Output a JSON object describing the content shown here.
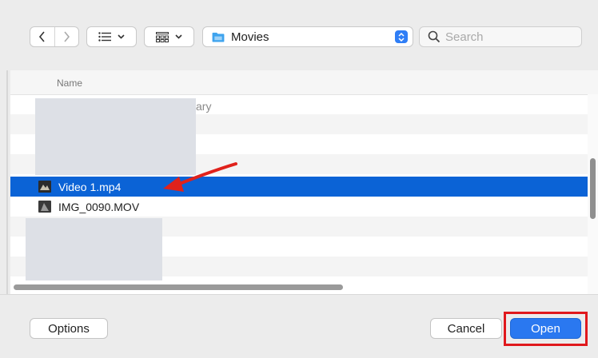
{
  "toolbar": {
    "back_icon": "chevron-left-icon",
    "forward_icon": "chevron-right-icon",
    "list_view_icon": "list-icon",
    "group_icon": "grid-icon",
    "dropdown_icon": "chevron-down-icon",
    "folder_name": "Movies",
    "folder_icon": "folder-icon",
    "stepper_icon": "up-down-chevron-icon",
    "search_placeholder": "Search"
  },
  "list": {
    "column_header": "Name",
    "partial_text": "ary",
    "files": [
      {
        "name": "Video 1.mp4",
        "selected": true,
        "icon": "video-thumbnail-icon"
      },
      {
        "name": "IMG_0090.MOV",
        "selected": false,
        "icon": "video-thumbnail-icon"
      }
    ]
  },
  "footer": {
    "options_label": "Options",
    "cancel_label": "Cancel",
    "open_label": "Open"
  },
  "colors": {
    "selection": "#0b63d6",
    "primary_button": "#2a78f0",
    "highlight": "#e0191d",
    "arrow": "#e0221c"
  }
}
